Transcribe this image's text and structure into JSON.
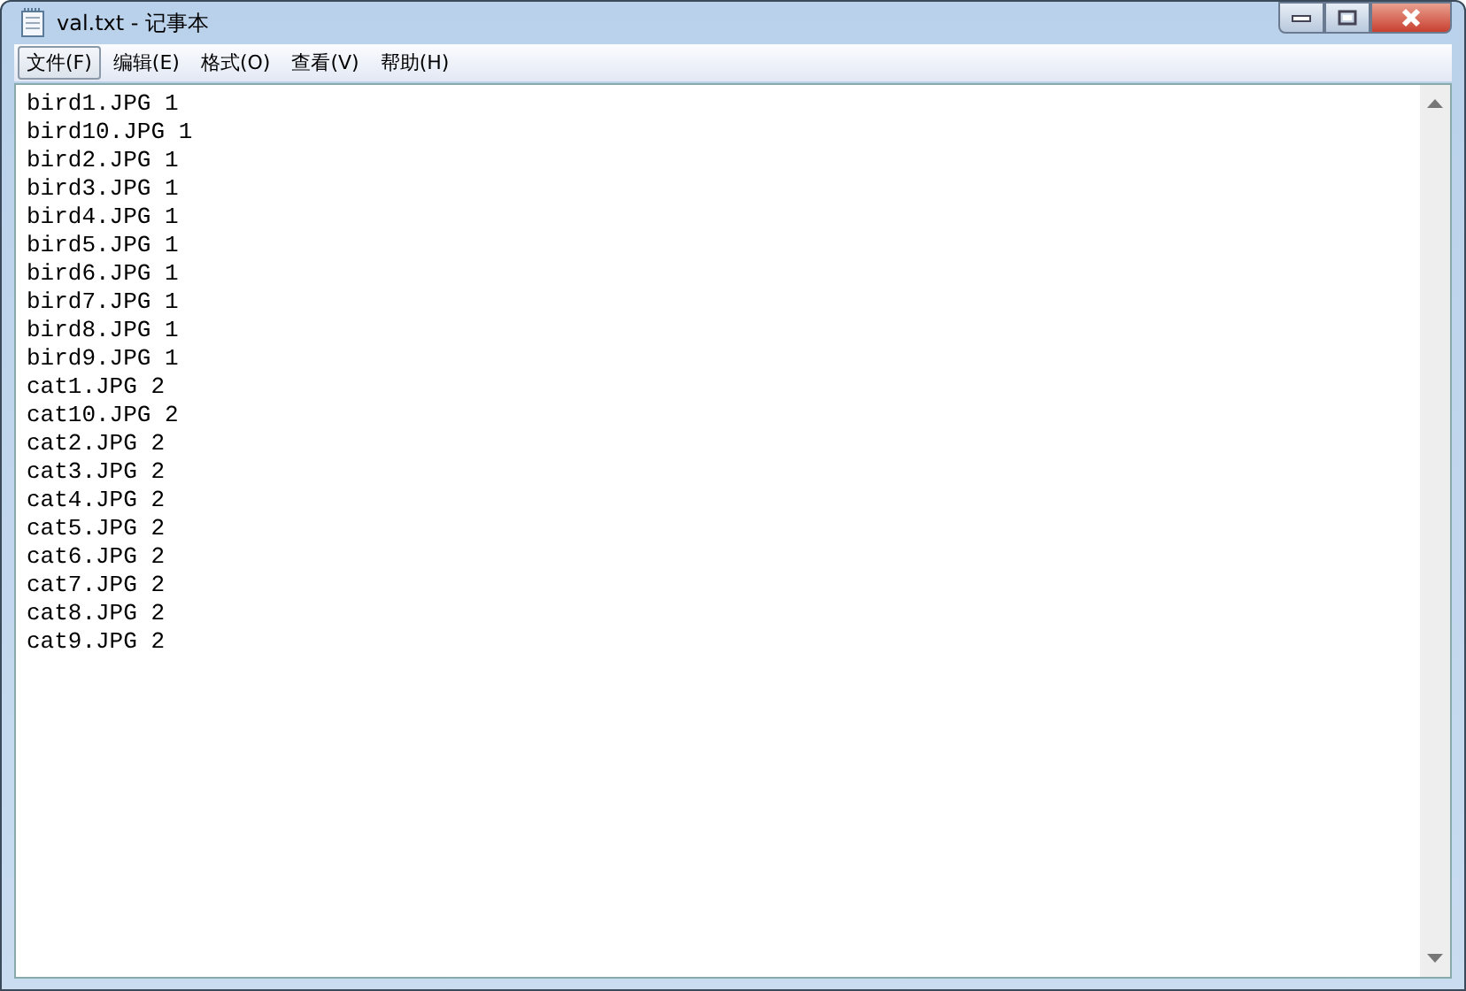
{
  "window": {
    "title": "val.txt - 记事本"
  },
  "menu": [
    {
      "label": "文件(F)",
      "selected": true
    },
    {
      "label": "编辑(E)",
      "selected": false
    },
    {
      "label": "格式(O)",
      "selected": false
    },
    {
      "label": "查看(V)",
      "selected": false
    },
    {
      "label": "帮助(H)",
      "selected": false
    }
  ],
  "editor": {
    "lines": [
      "bird1.JPG 1",
      "bird10.JPG 1",
      "bird2.JPG 1",
      "bird3.JPG 1",
      "bird4.JPG 1",
      "bird5.JPG 1",
      "bird6.JPG 1",
      "bird7.JPG 1",
      "bird8.JPG 1",
      "bird9.JPG 1",
      "cat1.JPG 2",
      "cat10.JPG 2",
      "cat2.JPG 2",
      "cat3.JPG 2",
      "cat4.JPG 2",
      "cat5.JPG 2",
      "cat6.JPG 2",
      "cat7.JPG 2",
      "cat8.JPG 2",
      "cat9.JPG 2"
    ]
  }
}
